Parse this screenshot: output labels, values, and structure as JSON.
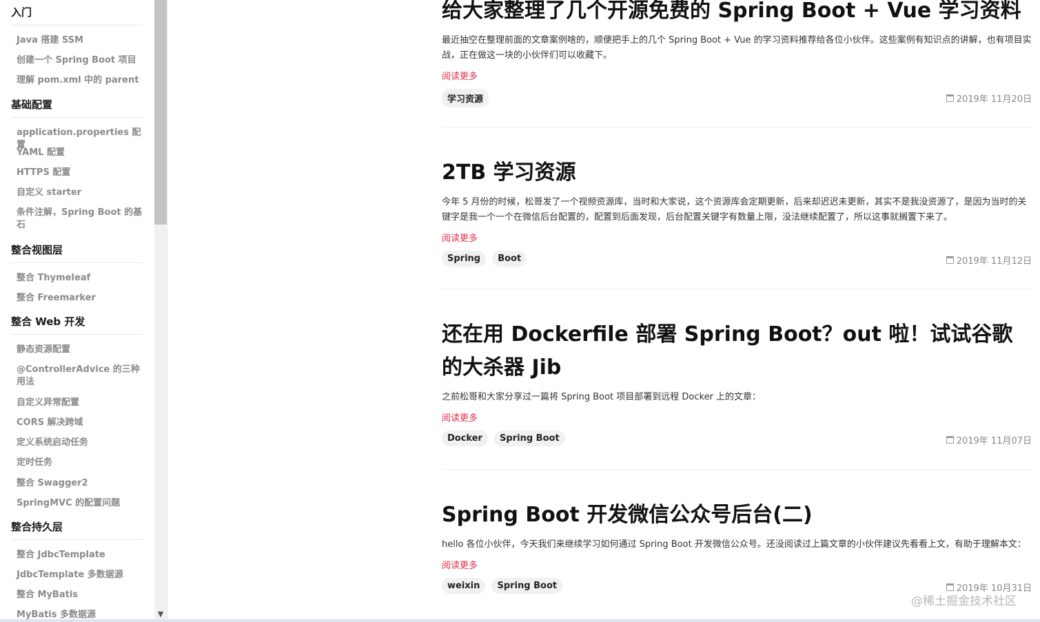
{
  "sidebar": {
    "sections": [
      {
        "title": "入门",
        "items": [
          "Java 搭建 SSM",
          "创建一个 Spring Boot 项目",
          "理解 pom.xml 中的 parent"
        ]
      },
      {
        "title": "基础配置",
        "items": [
          "application.properties 配置",
          "YAML 配置",
          "HTTPS 配置",
          "自定义 starter",
          "条件注解，Spring Boot 的基石"
        ]
      },
      {
        "title": "整合视图层",
        "items": [
          "整合 Thymeleaf",
          "整合 Freemarker"
        ]
      },
      {
        "title": "整合 Web 开发",
        "items": [
          "静态资源配置",
          "@ControllerAdvice 的三种用法",
          "自定义异常配置",
          "CORS 解决跨域",
          "定义系统启动任务",
          "定时任务",
          "整合 Swagger2",
          "SpringMVC 的配置问题"
        ]
      },
      {
        "title": "整合持久层",
        "items": [
          "整合 JdbcTemplate",
          "JdbcTemplate 多数据源",
          "整合 MyBatis",
          "MyBatis 多数据源"
        ]
      }
    ]
  },
  "articles": [
    {
      "title": "给大家整理了几个开源免费的 Spring Boot + Vue 学习资料",
      "summary": "最近抽空在整理前面的文章案例啥的，顺便把手上的几个 Spring Boot + Vue 的学习资料推荐给各位小伙伴。这些案例有知识点的讲解，也有项目实战，正在做这一块的小伙伴们可以收藏下。",
      "read_more": "阅读更多",
      "tags": [
        "学习资源"
      ],
      "date": "2019年 11月20日"
    },
    {
      "title": "2TB 学习资源",
      "summary": "今年 5 月份的时候，松哥发了一个视频资源库，当时和大家说，这个资源库会定期更新，后来却迟迟未更新，其实不是我没资源了，是因为当时的关键字是我一个一个在微信后台配置的，配置到后面发现，后台配置关键字有数量上限，没法继续配置了，所以这事就搁置下来了。",
      "read_more": "阅读更多",
      "tags": [
        "Spring",
        "Boot"
      ],
      "date": "2019年 11月12日"
    },
    {
      "title": "还在用 Dockerfile 部署 Spring Boot？out 啦！试试谷歌的大杀器 Jib",
      "summary": "之前松哥和大家分享过一篇将 Spring Boot 项目部署到远程 Docker 上的文章：",
      "read_more": "阅读更多",
      "tags": [
        "Docker",
        "Spring Boot"
      ],
      "date": "2019年 11月07日"
    },
    {
      "title": "Spring Boot 开发微信公众号后台(二)",
      "summary": "hello 各位小伙伴，今天我们来继续学习如何通过 Spring Boot 开发微信公众号。还没阅读过上篇文章的小伙伴建议先看看上文，有助于理解本文：",
      "read_more": "阅读更多",
      "tags": [
        "weixin",
        "Spring Boot"
      ],
      "date": "2019年 10月31日"
    }
  ],
  "watermark": "@稀土掘金技术社区",
  "icons": {
    "date": "calendar-icon",
    "scroll": "chevron-down-icon"
  }
}
